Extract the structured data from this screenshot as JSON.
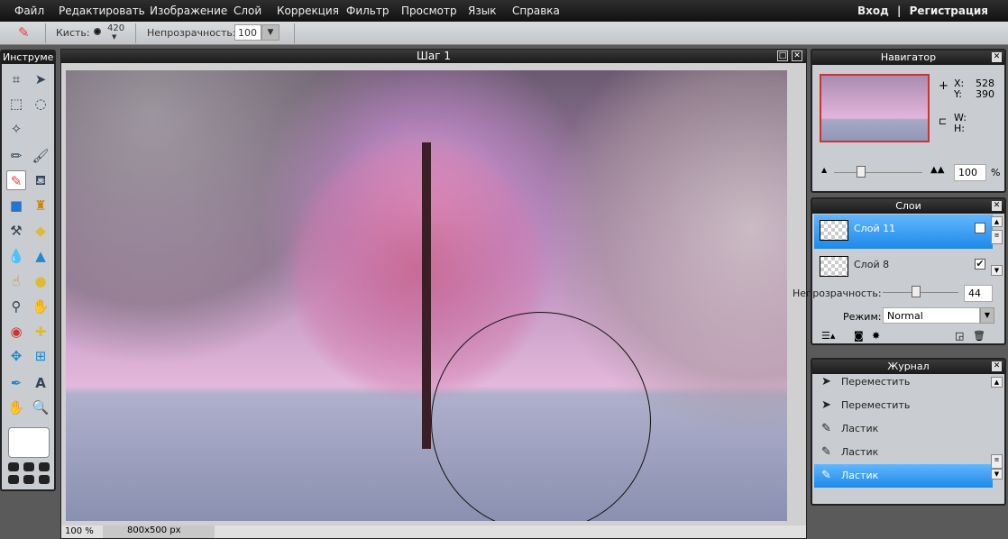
{
  "menu": {
    "items": [
      "Файл",
      "Редактировать",
      "Изображение",
      "Слой",
      "Коррекция",
      "Фильтр",
      "Просмотр",
      "Язык",
      "Справка"
    ],
    "login": "Вход",
    "sep": "|",
    "register": "Регистрация"
  },
  "options": {
    "brush_label": "Кисть:",
    "brush_size": "420",
    "opacity_label": "Непрозрачность:",
    "opacity_value": "100"
  },
  "tools": {
    "title": "Инструмент"
  },
  "document": {
    "title": "Шаг 1",
    "zoom": "100 %",
    "size": "800x500 px"
  },
  "navigator": {
    "title": "Навигатор",
    "x_label": "X:",
    "x": "528",
    "y_label": "Y:",
    "y": "390",
    "w_label": "W:",
    "h_label": "H:",
    "zoom": "100",
    "percent": "%"
  },
  "layers": {
    "title": "Слои",
    "items": [
      {
        "name": "Слой 11",
        "selected": true,
        "visible": true
      },
      {
        "name": "Слой 8",
        "selected": false,
        "visible": true
      }
    ],
    "opacity_label": "Непрозрачность:",
    "opacity": "44",
    "mode_label": "Режим:",
    "mode": "Normal"
  },
  "history": {
    "title": "Журнал",
    "items": [
      "Переместить",
      "Переместить",
      "Ластик",
      "Ластик",
      "Ластик"
    ]
  }
}
